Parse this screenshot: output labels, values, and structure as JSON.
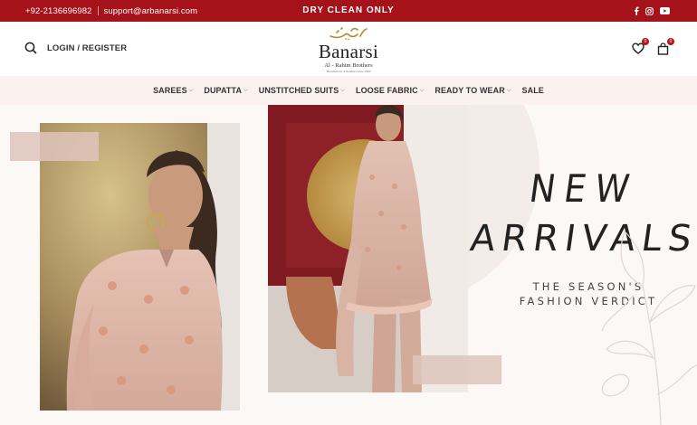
{
  "topbar": {
    "phone": "+92-2136696982",
    "email": "support@arbanarsi.com",
    "promo": "DRY CLEAN ONLY",
    "social": [
      "facebook-icon",
      "instagram-icon",
      "youtube-icon"
    ]
  },
  "header": {
    "login_label": "LOGIN / REGISTER",
    "logo": {
      "calligraphy": "بنارسی",
      "name": "Banarsi",
      "subtitle": "Al - Rahim Brothers",
      "tagline": "Manufacturer & Retailers since 1966"
    },
    "wishlist_count": "0",
    "cart_count": "0"
  },
  "nav": {
    "items": [
      {
        "label": "SAREES",
        "dropdown": true
      },
      {
        "label": "DUPATTA",
        "dropdown": true
      },
      {
        "label": "UNSTITCHED SUITS",
        "dropdown": true
      },
      {
        "label": "LOOSE FABRIC",
        "dropdown": true
      },
      {
        "label": "READY TO WEAR",
        "dropdown": true
      },
      {
        "label": "SALE",
        "dropdown": false
      }
    ]
  },
  "hero": {
    "headline_line1": "NEW",
    "headline_line2": "ARRIVALS",
    "tagline_line1": "THE SEASON'S",
    "tagline_line2": "FASHION VERDICT"
  },
  "colors": {
    "brand_red": "#a6121a",
    "nav_bg": "#fbf1ee",
    "hero_bg": "#fbf8f6",
    "swatch": "#dec4bb"
  }
}
